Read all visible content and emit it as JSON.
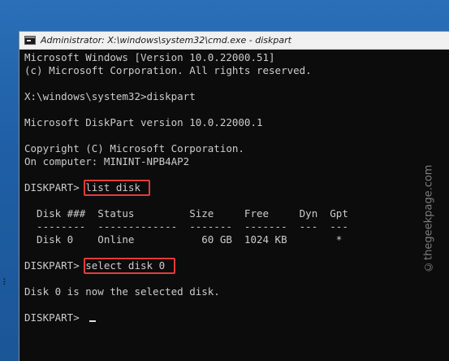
{
  "window": {
    "title": "Administrator: X:\\windows\\system32\\cmd.exe - diskpart"
  },
  "console": {
    "lines": [
      "Microsoft Windows [Version 10.0.22000.51]",
      "(c) Microsoft Corporation. All rights reserved.",
      "",
      "X:\\windows\\system32>diskpart",
      "",
      "Microsoft DiskPart version 10.0.22000.1",
      "",
      "Copyright (C) Microsoft Corporation.",
      "On computer: MININT-NPB4AP2",
      "",
      "DISKPART> list disk",
      "",
      "  Disk ###  Status         Size     Free     Dyn  Gpt",
      "  --------  -------------  -------  -------  ---  ---",
      "  Disk 0    Online           60 GB  1024 KB        *",
      "",
      "DISKPART> select disk 0",
      "",
      "Disk 0 is now the selected disk.",
      "",
      "DISKPART> "
    ],
    "highlighted_commands": [
      "list disk",
      "select disk 0"
    ]
  },
  "watermark": {
    "text": "©thegeekpage.com"
  },
  "colors": {
    "console_bg": "#0c0c0c",
    "console_fg": "#cccccc",
    "highlight_border": "#e53b3b",
    "titlebar_bg": "#f0f0f0",
    "desktop": "#1f5fa6"
  }
}
